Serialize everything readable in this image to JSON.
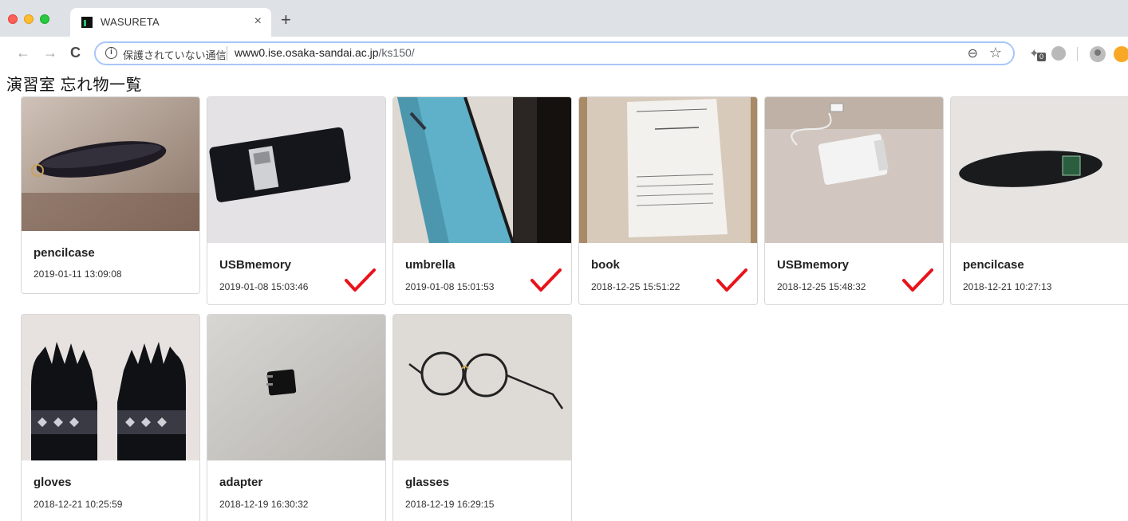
{
  "browser": {
    "tab_title": "WASURETA",
    "tab_close": "×",
    "new_tab": "+",
    "back": "←",
    "forward": "→",
    "reload": "C",
    "info": "i",
    "security_text": "保護されていない通信",
    "url_host": "www0.ise.osaka-sandai.ac.jp",
    "url_path": "/ks150/",
    "extension_badge": "0",
    "accent_color": "#a8c7fa"
  },
  "page": {
    "title": "演習室 忘れ物一覧"
  },
  "items": [
    {
      "name": "pencilcase",
      "date": "2019-01-11 13:09:08",
      "returned": false
    },
    {
      "name": "USBmemory",
      "date": "2019-01-08 15:03:46",
      "returned": true
    },
    {
      "name": "umbrella",
      "date": "2019-01-08 15:01:53",
      "returned": true
    },
    {
      "name": "book",
      "date": "2018-12-25 15:51:22",
      "returned": true
    },
    {
      "name": "USBmemory",
      "date": "2018-12-25 15:48:32",
      "returned": true
    },
    {
      "name": "pencilcase",
      "date": "2018-12-21 10:27:13",
      "returned": false
    },
    {
      "name": "gloves",
      "date": "2018-12-21 10:25:59",
      "returned": false
    },
    {
      "name": "adapter",
      "date": "2018-12-19 16:30:32",
      "returned": false
    },
    {
      "name": "glasses",
      "date": "2018-12-19 16:29:15",
      "returned": false
    }
  ],
  "icons": {
    "returned_mark": "check-icon",
    "returned_color": "#e8141b"
  }
}
